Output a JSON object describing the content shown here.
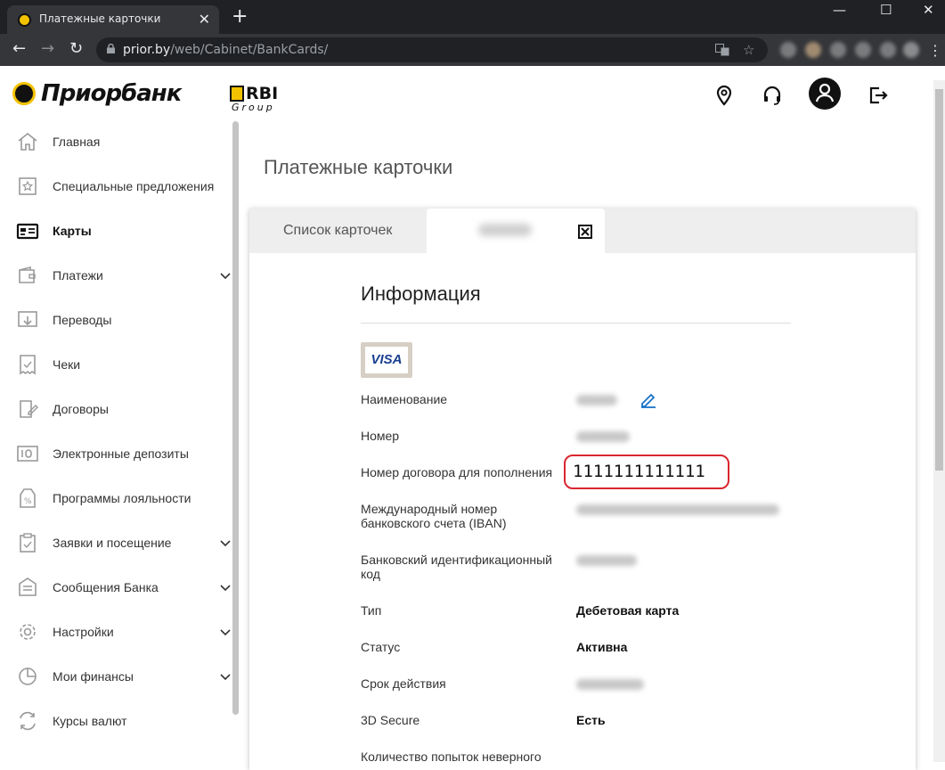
{
  "browser": {
    "tab_title": "Платежные карточки",
    "tab_close": "✕",
    "new_tab": "+",
    "url_host": "prior.by",
    "url_path": "/web/Cabinet/BankCards/",
    "minimize": "—",
    "maximize": "☐",
    "close": "✕",
    "back": "←",
    "forward": "→",
    "reload": "↻",
    "bookmark": "☆",
    "menu": "⋮"
  },
  "header": {
    "brand": "Приорбанк",
    "partner": "RBI",
    "partner_sub": "Group"
  },
  "sidebar": {
    "items": [
      {
        "label": "Главная",
        "icon": "home-icon",
        "expandable": false,
        "active": false
      },
      {
        "label": "Специальные предложения",
        "icon": "star-offer-icon",
        "expandable": false,
        "active": false
      },
      {
        "label": "Карты",
        "icon": "card-icon",
        "expandable": false,
        "active": true
      },
      {
        "label": "Платежи",
        "icon": "wallet-icon",
        "expandable": true,
        "active": false
      },
      {
        "label": "Переводы",
        "icon": "transfer-icon",
        "expandable": false,
        "active": false
      },
      {
        "label": "Чеки",
        "icon": "receipt-icon",
        "expandable": false,
        "active": false
      },
      {
        "label": "Договоры",
        "icon": "contract-icon",
        "expandable": false,
        "active": false
      },
      {
        "label": "Электронные депозиты",
        "icon": "deposit-icon",
        "expandable": false,
        "active": false
      },
      {
        "label": "Программы лояльности",
        "icon": "loyalty-icon",
        "expandable": false,
        "active": false
      },
      {
        "label": "Заявки и посещение",
        "icon": "clipboard-icon",
        "expandable": true,
        "active": false
      },
      {
        "label": "Сообщения Банка",
        "icon": "message-icon",
        "expandable": true,
        "active": false
      },
      {
        "label": "Настройки",
        "icon": "gear-icon",
        "expandable": true,
        "active": false
      },
      {
        "label": "Мои финансы",
        "icon": "pie-chart-icon",
        "expandable": true,
        "active": false
      },
      {
        "label": "Курсы валют",
        "icon": "exchange-icon",
        "expandable": false,
        "active": false
      }
    ]
  },
  "main": {
    "page_title": "Платежные карточки",
    "tabs": [
      {
        "label": "Список карточек"
      }
    ],
    "section_title": "Информация",
    "card_brand": "VISA",
    "fields": [
      {
        "label": "Наименование",
        "value": null
      },
      {
        "label": "Номер",
        "value": null
      },
      {
        "label": "Номер договора для пополнения",
        "value": "1111111111111"
      },
      {
        "label": "Международный номер банковского счета (IBAN)",
        "value": null
      },
      {
        "label": "Банковский идентификационный код",
        "value": null
      },
      {
        "label": "Тип",
        "value": "Дебетовая карта"
      },
      {
        "label": "Статус",
        "value": "Активна"
      },
      {
        "label": "Срок действия",
        "value": null
      },
      {
        "label": "3D Secure",
        "value": "Есть"
      },
      {
        "label": "Количество попыток неверного",
        "value": null
      }
    ]
  },
  "colors": {
    "brand_yellow": "#f2c200",
    "highlight_red": "#d9262f",
    "edit_blue": "#1a73c8"
  }
}
